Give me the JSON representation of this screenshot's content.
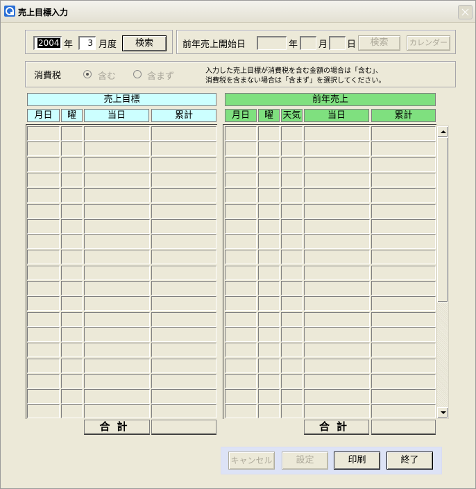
{
  "window": {
    "title": "売上目標入力"
  },
  "search_bar": {
    "year_value": "2004",
    "year_unit": "年",
    "month_value": "3",
    "month_unit": "月度",
    "search_label": "検索"
  },
  "prev_year": {
    "start_label": "前年売上開始日",
    "year_unit": "年",
    "month_unit": "月",
    "day_unit": "日",
    "search_label": "検索",
    "calendar_label": "カレンダー"
  },
  "tax": {
    "label": "消費税",
    "option_include": "含む",
    "option_exclude": "含まず",
    "selected": "include",
    "note_line1": "入力した売上目標が消費税を含む金額の場合は「含む」、",
    "note_line2": "消費税を含まない場合は「含まず」を選択してください。"
  },
  "target_table": {
    "title": "売上目標",
    "columns": [
      "月日",
      "曜",
      "当日",
      "累計"
    ],
    "header_color": "#ccffff"
  },
  "prev_table": {
    "title": "前年売上",
    "columns": [
      "月日",
      "曜",
      "天気",
      "当日",
      "累計"
    ],
    "header_color": "#7fe07f"
  },
  "totals": {
    "label": "合計"
  },
  "footer": {
    "cancel_label": "キャンセル",
    "set_label": "設定",
    "print_label": "印刷",
    "exit_label": "終了"
  }
}
